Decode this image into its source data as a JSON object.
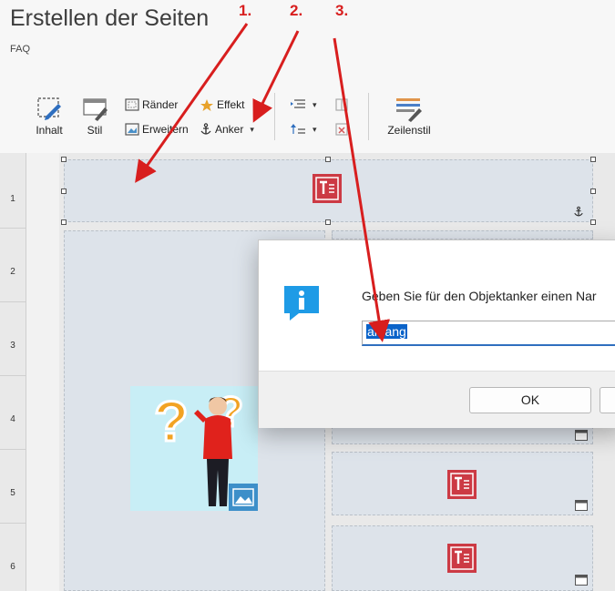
{
  "page": {
    "title": "Erstellen der Seiten",
    "subtitle": "FAQ"
  },
  "toolbar": {
    "inhalt_label": "Inhalt",
    "stil_label": "Stil",
    "raender_label": "Ränder",
    "effekt_label": "Effekt",
    "erweitern_label": "Erweitern",
    "anker_label": "Anker",
    "zeilenstil_label": "Zeilenstil"
  },
  "grid": {
    "rows": [
      "1",
      "2",
      "3",
      "4",
      "5",
      "6"
    ]
  },
  "dialog": {
    "message": "Geben Sie für den Objektanker einen Nar",
    "input_value": "anfang",
    "ok_label": "OK"
  },
  "annotations": {
    "step1": "1.",
    "step2": "2.",
    "step3": "3."
  },
  "colors": {
    "annotation_red": "#d81e1e",
    "text_icon_red": "#cc3a44",
    "cell_bg": "#dde3ea",
    "info_blue": "#1e9be6",
    "selection_blue": "#0a63c9"
  }
}
